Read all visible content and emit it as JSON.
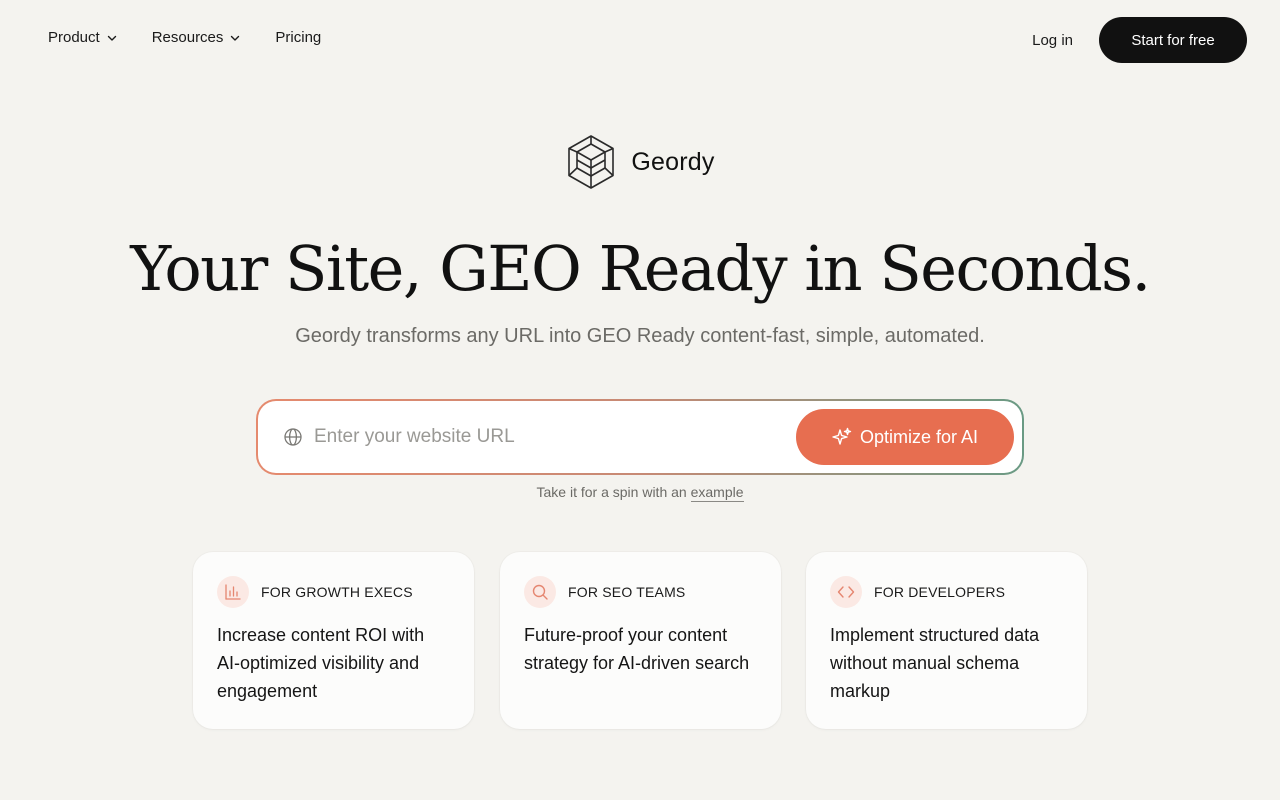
{
  "nav": {
    "product": "Product",
    "resources": "Resources",
    "pricing": "Pricing",
    "login": "Log in",
    "cta": "Start for free"
  },
  "brand": {
    "name": "Geordy",
    "logo_icon": "hex-cube-logo-icon"
  },
  "hero": {
    "headline": "Your Site, GEO Ready in Seconds.",
    "subhead": "Geordy transforms any URL into GEO Ready content-fast, simple, automated."
  },
  "url_form": {
    "placeholder": "Enter your website URL",
    "value": "",
    "button_label": "Optimize for AI",
    "input_icon": "globe-icon",
    "button_icon": "sparkles-icon"
  },
  "spin_note": {
    "text": "Take it for a spin with an ",
    "link": "example"
  },
  "cards": [
    {
      "tag": "FOR GROWTH EXECS",
      "text": "Increase content ROI with AI-optimized visibility and engagement",
      "icon": "bar-chart-icon"
    },
    {
      "tag": "FOR SEO TEAMS",
      "text": "Future-proof your content strategy for AI-driven search",
      "icon": "search-icon"
    },
    {
      "tag": "FOR DEVELOPERS",
      "text": "Implement structured data without manual schema markup",
      "icon": "code-icon"
    }
  ],
  "colors": {
    "background": "#f4f3ef",
    "accent": "#e76e50",
    "cta_dark": "#111111",
    "icon_tint": "#fbe9e4"
  }
}
